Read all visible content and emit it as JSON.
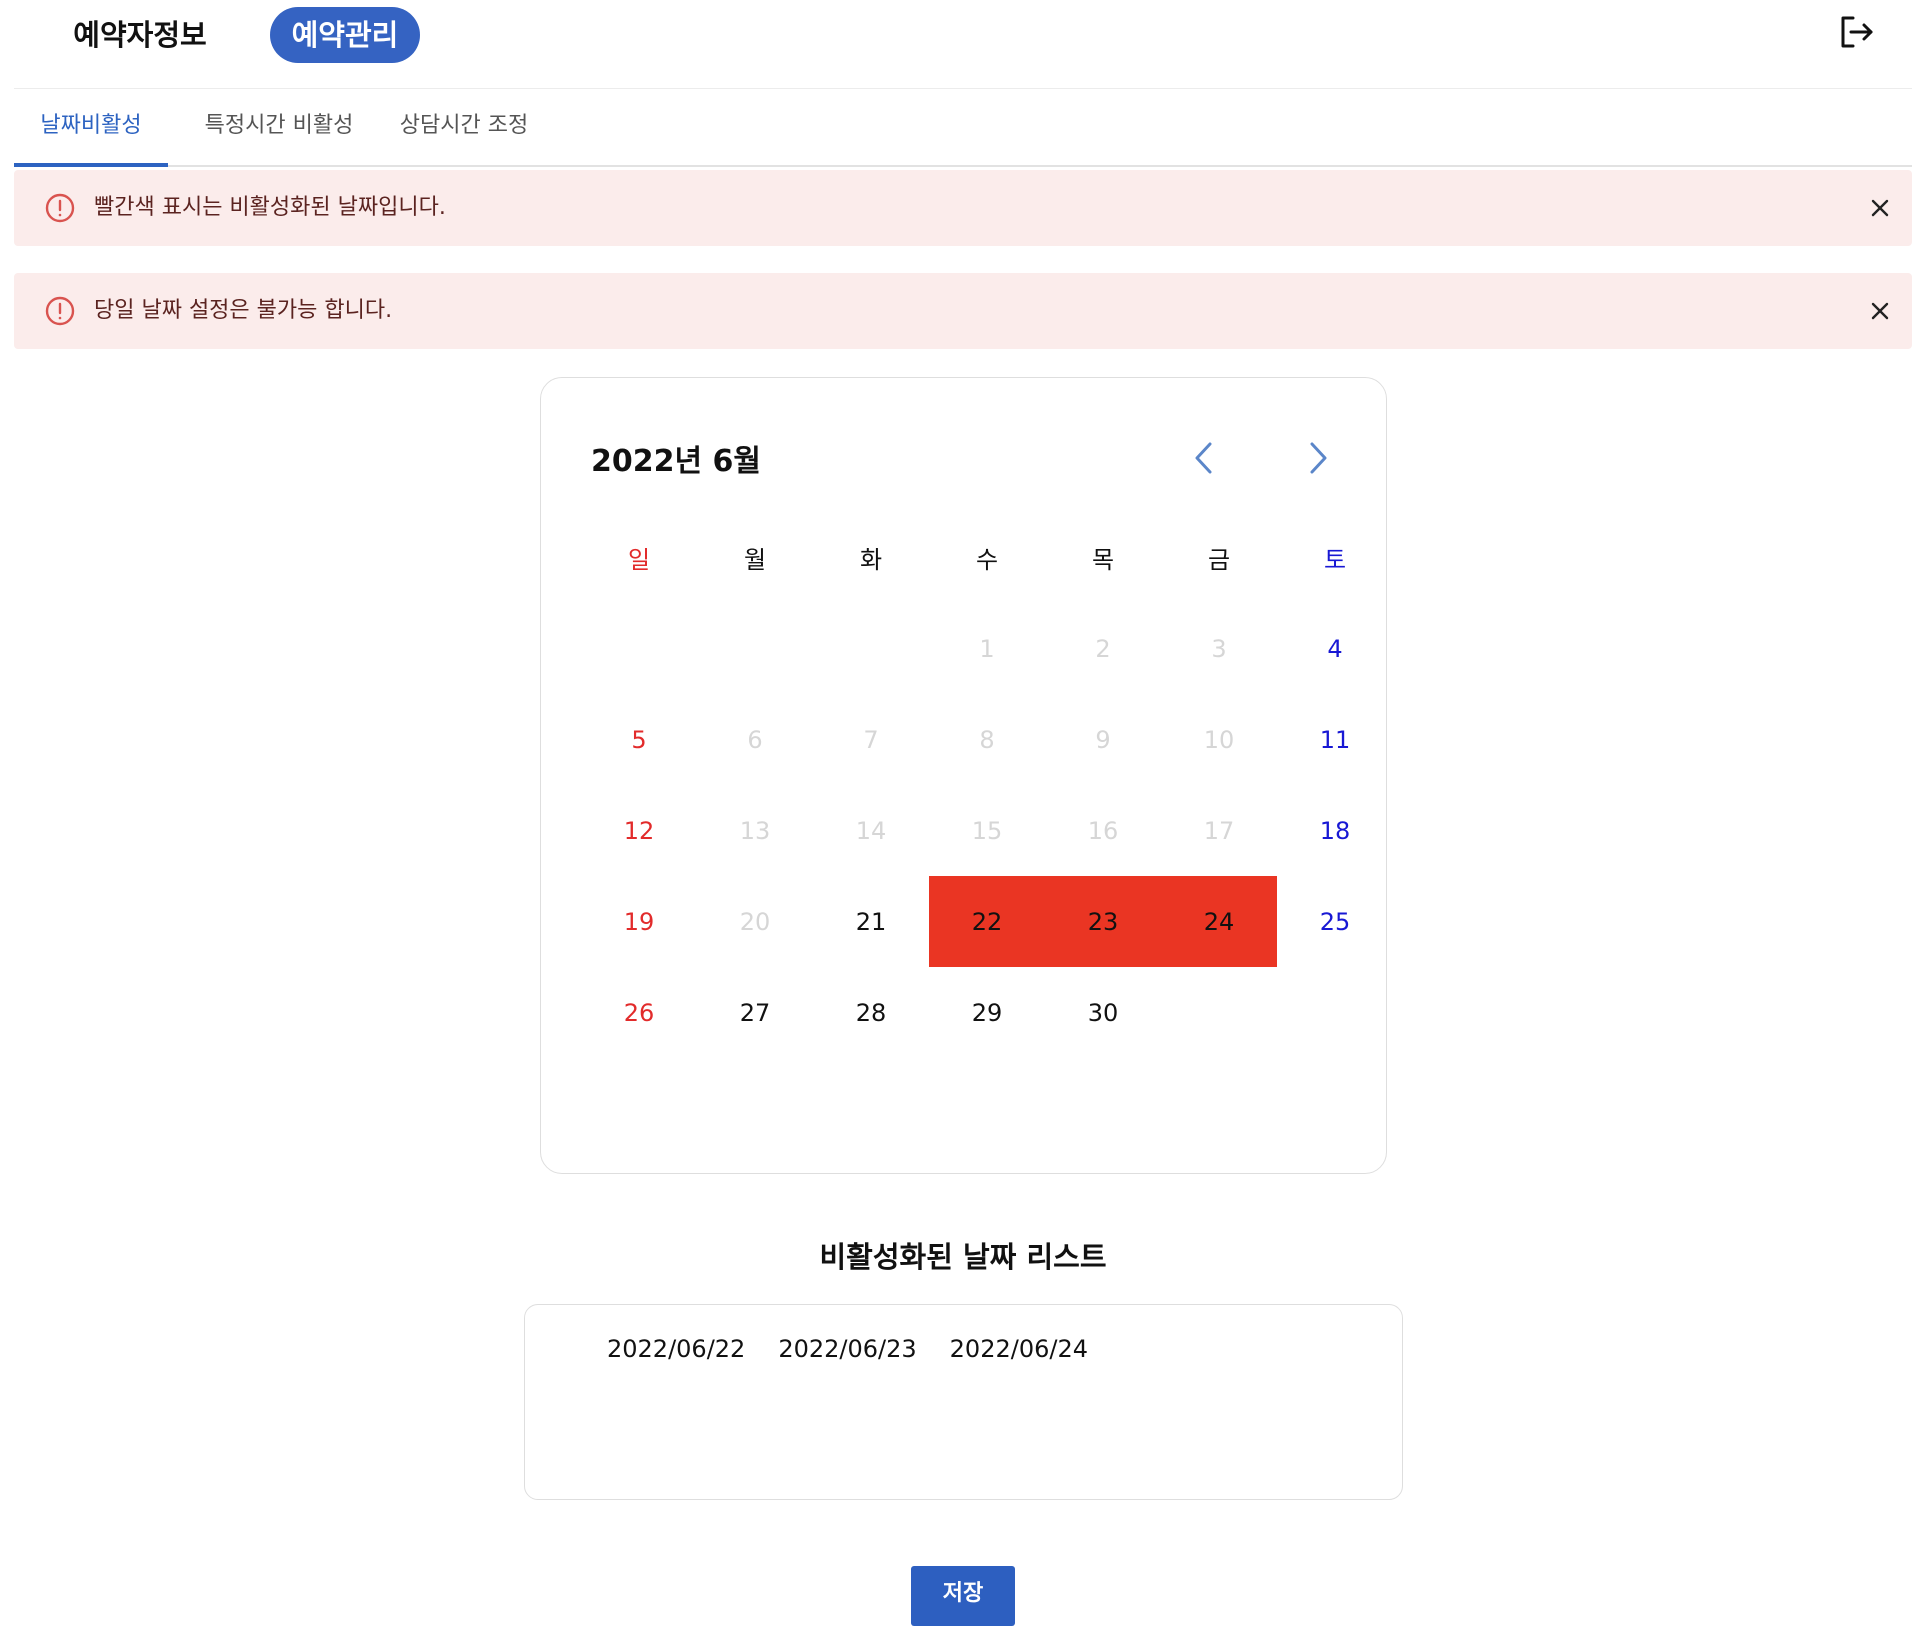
{
  "topnav": {
    "info_label": "예약자정보",
    "manage_label": "예약관리",
    "logout_icon": "logout-icon"
  },
  "tabs": [
    {
      "label": "날짜비활성",
      "active": true
    },
    {
      "label": "특정시간 비활성",
      "active": false
    },
    {
      "label": "상담시간 조정",
      "active": false
    }
  ],
  "alerts": [
    {
      "text": "빨간색 표시는 비활성화된 날짜입니다.",
      "icon": "alert-circle-icon",
      "close_icon": "close-icon"
    },
    {
      "text": "당일 날짜 설정은 불가능 합니다.",
      "icon": "alert-circle-icon",
      "close_icon": "close-icon"
    }
  ],
  "calendar": {
    "title": "2022년 6월",
    "prev_icon": "chevron-left-icon",
    "next_icon": "chevron-right-icon",
    "weekdays": [
      "일",
      "월",
      "화",
      "수",
      "목",
      "금",
      "토"
    ],
    "weeks": [
      [
        {
          "d": "",
          "s": "empty"
        },
        {
          "d": "",
          "s": "empty"
        },
        {
          "d": "",
          "s": "empty"
        },
        {
          "d": "1",
          "s": "past"
        },
        {
          "d": "2",
          "s": "past"
        },
        {
          "d": "3",
          "s": "past"
        },
        {
          "d": "4",
          "s": "sat"
        }
      ],
      [
        {
          "d": "5",
          "s": "sun"
        },
        {
          "d": "6",
          "s": "past"
        },
        {
          "d": "7",
          "s": "past"
        },
        {
          "d": "8",
          "s": "past"
        },
        {
          "d": "9",
          "s": "past"
        },
        {
          "d": "10",
          "s": "past"
        },
        {
          "d": "11",
          "s": "sat"
        }
      ],
      [
        {
          "d": "12",
          "s": "sun"
        },
        {
          "d": "13",
          "s": "past"
        },
        {
          "d": "14",
          "s": "past"
        },
        {
          "d": "15",
          "s": "past"
        },
        {
          "d": "16",
          "s": "past"
        },
        {
          "d": "17",
          "s": "past"
        },
        {
          "d": "18",
          "s": "sat"
        }
      ],
      [
        {
          "d": "19",
          "s": "sun"
        },
        {
          "d": "20",
          "s": "past"
        },
        {
          "d": "21",
          "s": "normal"
        },
        {
          "d": "22",
          "s": "disabled-date"
        },
        {
          "d": "23",
          "s": "disabled-date"
        },
        {
          "d": "24",
          "s": "disabled-date"
        },
        {
          "d": "25",
          "s": "sat"
        }
      ],
      [
        {
          "d": "26",
          "s": "sun"
        },
        {
          "d": "27",
          "s": "normal"
        },
        {
          "d": "28",
          "s": "normal"
        },
        {
          "d": "29",
          "s": "normal"
        },
        {
          "d": "30",
          "s": "normal"
        },
        {
          "d": "",
          "s": "empty"
        },
        {
          "d": "",
          "s": "empty"
        }
      ]
    ],
    "colors": {
      "disabled": "#ea3523",
      "sunday": "#e22b2b",
      "saturday": "#1818d4",
      "past": "#d6d6d6",
      "accent": "#2d63c1"
    }
  },
  "disabled_list": {
    "heading": "비활성화된 날짜 리스트",
    "dates": [
      "2022/06/22",
      "2022/06/23",
      "2022/06/24"
    ]
  },
  "save_label": "저장"
}
